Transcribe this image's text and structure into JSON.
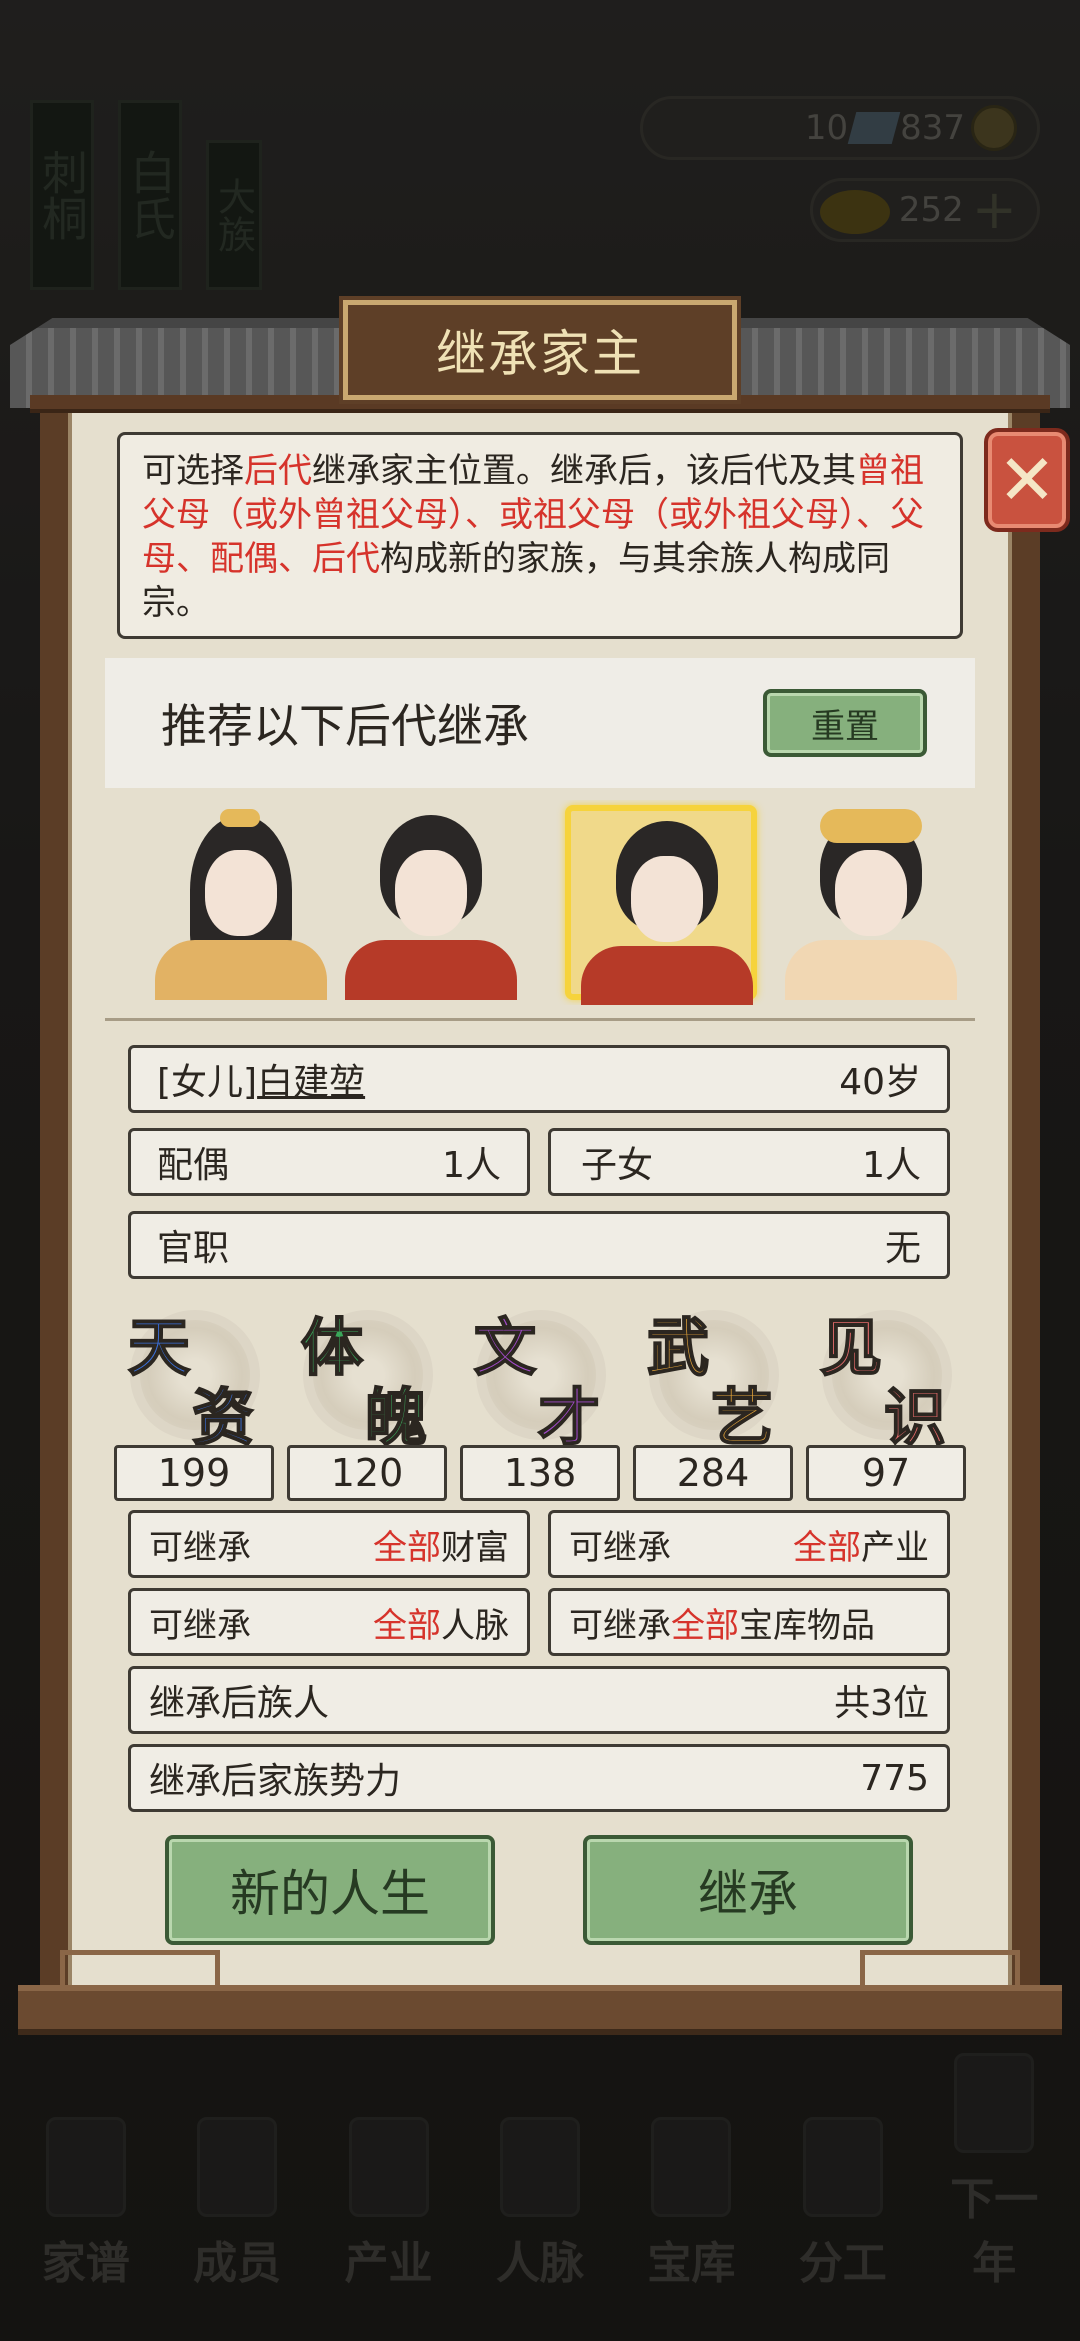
{
  "background": {
    "resources": {
      "gem_count": "10",
      "coin_count": "837",
      "gold_count": "252"
    },
    "banners": [
      "刺桐",
      "白氏",
      "大族"
    ],
    "bottom_nav": [
      "家谱",
      "成员",
      "产业",
      "人脉",
      "宝库",
      "分工",
      "下一年"
    ]
  },
  "dialog": {
    "title": "继承家主",
    "description": {
      "p1": "可选择",
      "p2": "后代",
      "p3": "继承家主位置。继承后，该后代及其",
      "p4": "曾祖父母（或外曾祖父母）、或祖父母（或外祖父母）、父母、配偶、后代",
      "p5": "构成新的家族，与其余族人构成同宗。"
    },
    "recommend_label": "推荐以下后代继承",
    "reset_label": "重置",
    "selected": {
      "relation": "[女儿]",
      "name": "白建堃",
      "age": "40岁"
    },
    "spouse_label": "配偶",
    "spouse_value": "1人",
    "children_label": "子女",
    "children_value": "1人",
    "office_label": "官职",
    "office_value": "无",
    "attributes": [
      {
        "c1": "天",
        "c2": "资",
        "color": "#3a6fd8",
        "value": "199"
      },
      {
        "c1": "体",
        "c2": "魄",
        "color": "#3aa65a",
        "value": "120"
      },
      {
        "c1": "文",
        "c2": "才",
        "color": "#a24ac9",
        "value": "138"
      },
      {
        "c1": "武",
        "c2": "艺",
        "color": "#e3a43a",
        "value": "284"
      },
      {
        "c1": "见",
        "c2": "识",
        "color": "#e46a6a",
        "value": "97"
      }
    ],
    "inherit": {
      "prefix": "可继承",
      "all": "全部",
      "wealth": "财富",
      "property": "产业",
      "network": "人脉",
      "treasury": "宝库物品"
    },
    "members_label": "继承后族人",
    "members_value": "共3位",
    "power_label": "继承后家族势力",
    "power_value": "775",
    "new_life_label": "新的人生",
    "inherit_label": "继承",
    "close_glyph": "✕"
  },
  "colors": {
    "accent_red": "#d6332b",
    "button_green": "#86b07d",
    "highlight_yellow": "#f6d33c"
  }
}
